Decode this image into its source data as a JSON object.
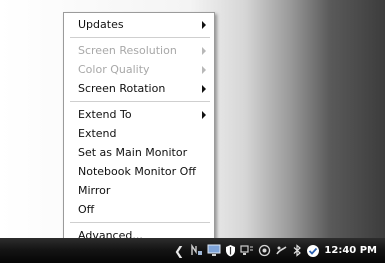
{
  "context_menu": {
    "items": [
      {
        "label": "Updates",
        "submenu": true,
        "disabled": false
      },
      {
        "label": "Screen Resolution",
        "submenu": true,
        "disabled": true
      },
      {
        "label": "Color Quality",
        "submenu": true,
        "disabled": true
      },
      {
        "label": "Screen Rotation",
        "submenu": true,
        "disabled": false
      },
      {
        "label": "Extend To",
        "submenu": true,
        "disabled": false
      },
      {
        "label": "Extend",
        "submenu": false,
        "disabled": false
      },
      {
        "label": "Set as Main Monitor",
        "submenu": false,
        "disabled": false
      },
      {
        "label": "Notebook Monitor Off",
        "submenu": false,
        "disabled": false
      },
      {
        "label": "Mirror",
        "submenu": false,
        "disabled": false
      },
      {
        "label": "Off",
        "submenu": false,
        "disabled": false
      },
      {
        "label": "Advanced...",
        "submenu": false,
        "disabled": false
      }
    ]
  },
  "taskbar": {
    "clock": "12:40 PM",
    "tray_icons": [
      "show-hidden-icons-chevron",
      "network-icon",
      "display-adapter-icon",
      "security-shield-icon",
      "connection-icon",
      "speaker-icon",
      "power-icon",
      "bluetooth-icon",
      "system-monitor-icon"
    ]
  },
  "colors": {
    "menu_background": "#ffffff",
    "menu_border": "#9b9b9b",
    "disabled_text": "#a8a8a8",
    "taskbar": "#151515"
  }
}
